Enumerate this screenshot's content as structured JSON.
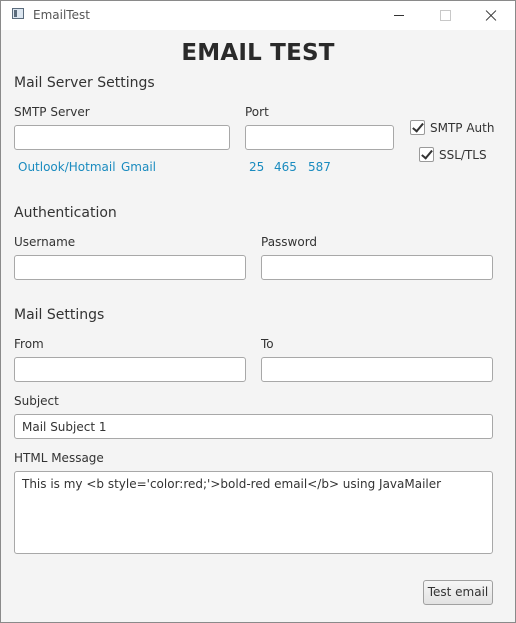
{
  "window": {
    "title": "EmailTest"
  },
  "header": {
    "title": "EMAIL TEST"
  },
  "mail_server": {
    "section_title": "Mail Server Settings",
    "smtp_server_label": "SMTP Server",
    "smtp_server_value": "",
    "port_label": "Port",
    "port_value": "",
    "host_presets": [
      "Outlook/Hotmail",
      "Gmail"
    ],
    "port_presets": [
      "25",
      "465",
      "587"
    ],
    "smtp_auth": {
      "label": "SMTP Auth",
      "checked": true
    },
    "ssl_tls": {
      "label": "SSL/TLS",
      "checked": true
    }
  },
  "authentication": {
    "section_title": "Authentication",
    "username_label": "Username",
    "username_value": "",
    "password_label": "Password",
    "password_value": ""
  },
  "mail_settings": {
    "section_title": "Mail Settings",
    "from_label": "From",
    "from_value": "",
    "to_label": "To",
    "to_value": "",
    "subject_label": "Subject",
    "subject_value": "Mail Subject 1",
    "message_label": "HTML Message",
    "message_value": "This is my <b style='color:red;'>bold-red email</b> using JavaMailer"
  },
  "actions": {
    "test_email_label": "Test email"
  },
  "colors": {
    "link": "#1a8bbf",
    "background": "#f4f4f4"
  }
}
